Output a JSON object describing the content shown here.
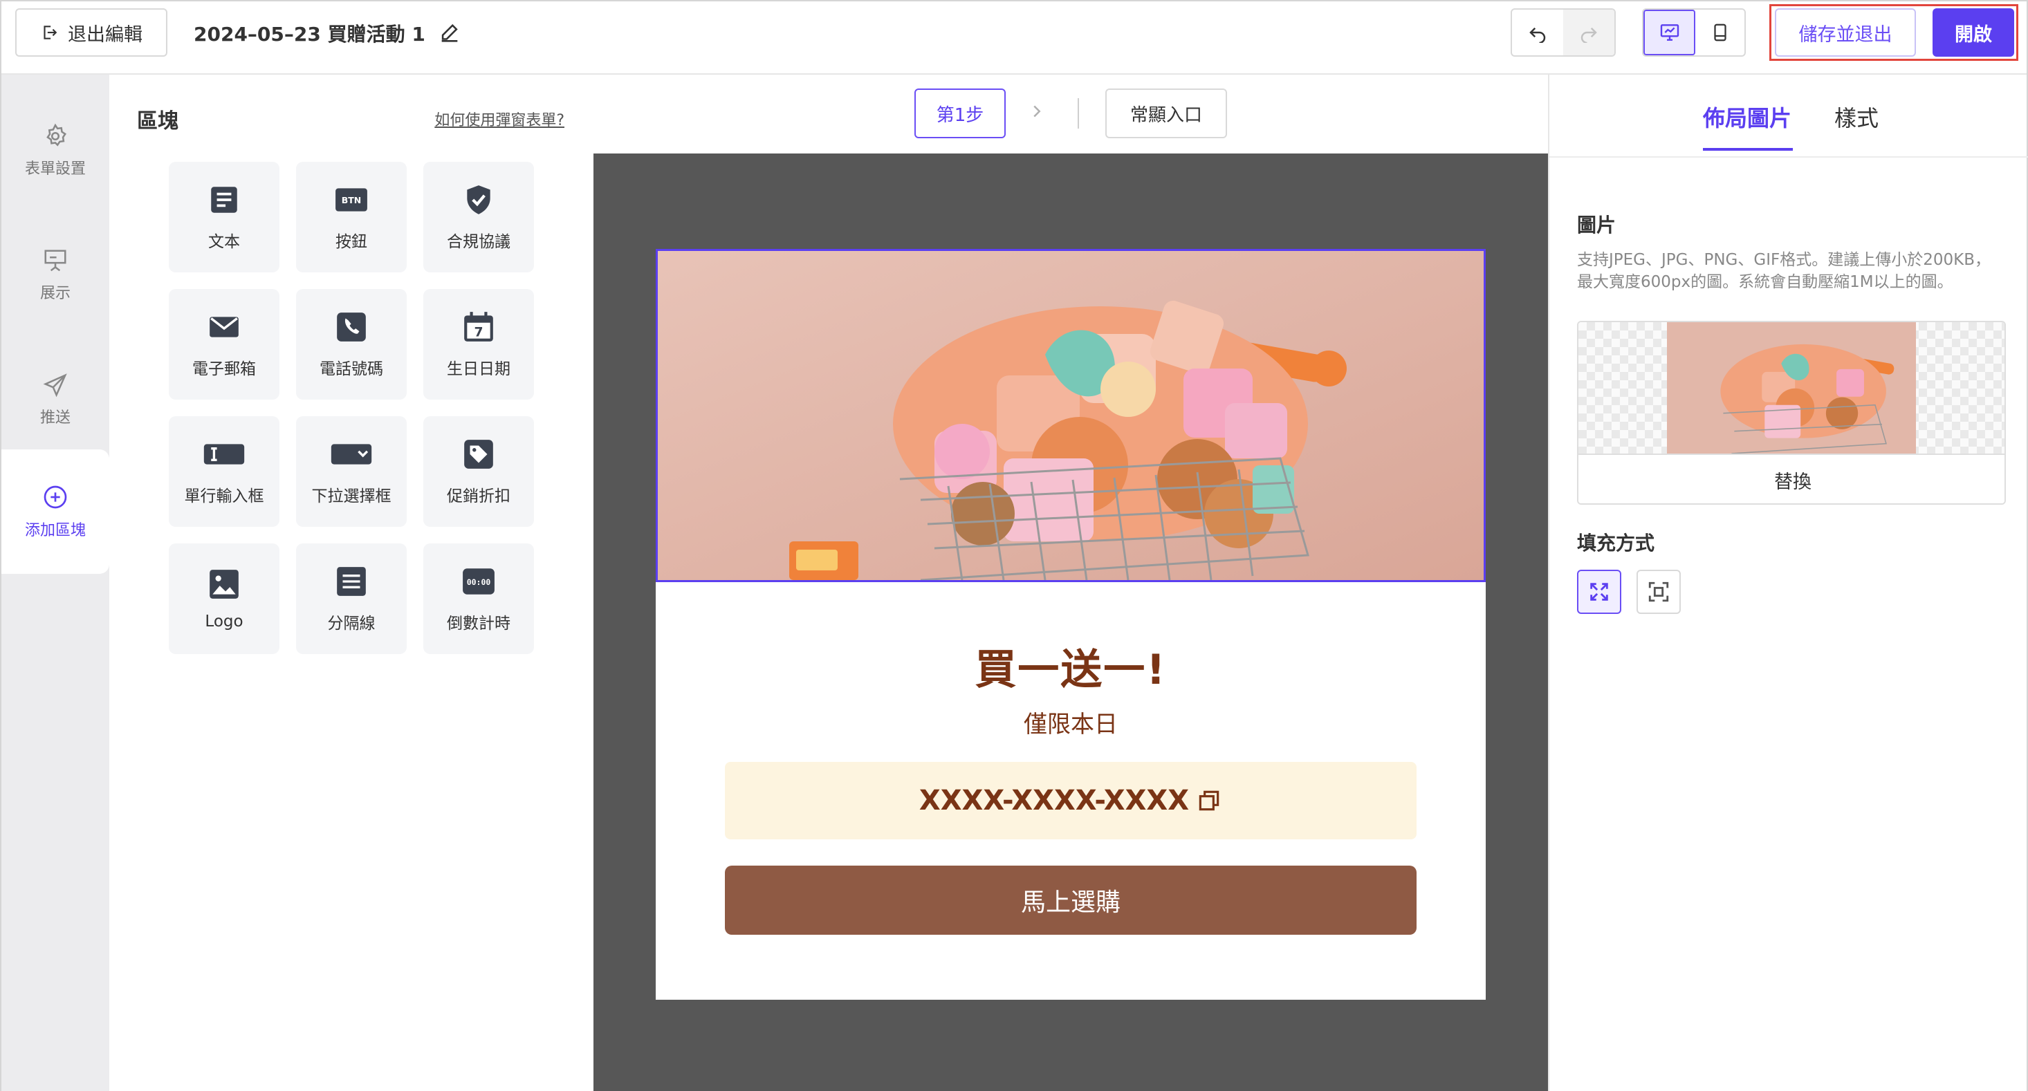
{
  "topbar": {
    "exit_label": "退出編輯",
    "doc_title": "2024–05–23 買贈活動 1",
    "save_exit_label": "儲存並退出",
    "open_label": "開啟"
  },
  "leftnav": {
    "items": [
      {
        "label": "表單設置",
        "icon": "gear-icon"
      },
      {
        "label": "展示",
        "icon": "presentation-icon"
      },
      {
        "label": "推送",
        "icon": "send-icon"
      },
      {
        "label": "添加區塊",
        "icon": "plus-circle-icon"
      }
    ]
  },
  "blocks": {
    "title": "區塊",
    "help_link": "如何使用彈窗表單?",
    "tiles": [
      {
        "label": "文本",
        "icon": "text-icon"
      },
      {
        "label": "按鈕",
        "icon": "button-icon",
        "badge": "BTN"
      },
      {
        "label": "合規協議",
        "icon": "shield-check-icon"
      },
      {
        "label": "電子郵箱",
        "icon": "envelope-icon"
      },
      {
        "label": "電話號碼",
        "icon": "phone-icon"
      },
      {
        "label": "生日日期",
        "icon": "calendar-icon",
        "badge": "7"
      },
      {
        "label": "單行輸入框",
        "icon": "text-input-icon"
      },
      {
        "label": "下拉選擇框",
        "icon": "dropdown-icon"
      },
      {
        "label": "促銷折扣",
        "icon": "tag-icon"
      },
      {
        "label": "Logo",
        "icon": "image-icon"
      },
      {
        "label": "分隔線",
        "icon": "divider-icon"
      },
      {
        "label": "倒數計時",
        "icon": "countdown-icon",
        "badge": "00:00"
      }
    ]
  },
  "canvas": {
    "step_label": "第1步",
    "entry_label": "常顯入口",
    "popup": {
      "headline": "買一送一!",
      "subline": "僅限本日",
      "coupon_code": "XXXX-XXXX-XXXX",
      "cta": "馬上選購"
    }
  },
  "rightpanel": {
    "tabs": [
      "佈局圖片",
      "樣式"
    ],
    "image_label": "圖片",
    "image_hint": "支持JPEG、JPG、PNG、GIF格式。建議上傳小於200KB，最大寬度600px的圖。系統會自動壓縮1M以上的圖。",
    "replace_label": "替換",
    "fill_label": "填充方式"
  },
  "colors": {
    "accent": "#5b3ff0",
    "headline": "#7a3415",
    "cta_bg": "#8f5a44",
    "coupon_bg": "#fdf4df",
    "canvas_bg": "#575757",
    "highlight_frame": "#e2453c"
  }
}
